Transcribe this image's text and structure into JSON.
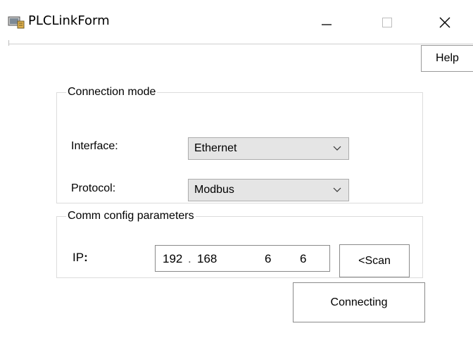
{
  "window": {
    "title": "PLCLinkForm",
    "controls": {
      "minimize": "minimize",
      "maximize": "maximize",
      "close": "close"
    }
  },
  "toolbar": {
    "help_label": "Help"
  },
  "connection_mode": {
    "legend": "Connection mode",
    "interface_label": "Interface:",
    "interface_value": "Ethernet",
    "protocol_label": "Protocol:",
    "protocol_value": "Modbus"
  },
  "comm_config": {
    "legend": "Comm config parameters",
    "ip_label": "IP",
    "ip_colon": ":",
    "ip_octets": [
      "192",
      "168",
      "6",
      "6"
    ],
    "ip_separator": ".",
    "scan_label": "<Scan"
  },
  "actions": {
    "connect_label": "Connecting"
  },
  "icons": {
    "app": "plc-link-app-icon",
    "dropdown": "chevron-down-icon"
  },
  "colors": {
    "combo_bg": "#e5e5e5",
    "border": "#8a8a8a",
    "group_border": "#dcdcdc"
  }
}
